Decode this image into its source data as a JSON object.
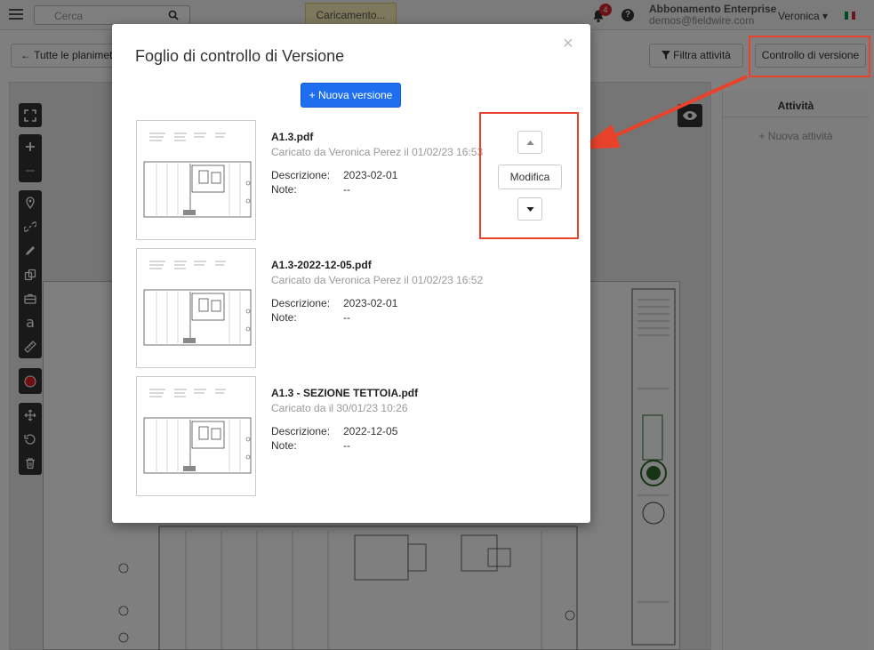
{
  "topbar": {
    "search_placeholder": "Cerca",
    "loading_text": "Caricamento...",
    "notification_count": "4",
    "help_label": "?",
    "plan": "Abbonamento Enterprise",
    "email": "demos@fieldwire.com",
    "user_name": "Veronica ▾",
    "flag_colors": [
      "#009246",
      "#ffffff",
      "#ce2b37"
    ]
  },
  "toolbar": {
    "back_label": "← Tutte le planimet",
    "filter_label": "Filtra attività",
    "version_control_label": "Controllo di versione"
  },
  "side_panel": {
    "title": "Attività",
    "add_label": "+ Nuova attività"
  },
  "tools": {
    "groups": [
      [
        "fullscreen-icon"
      ],
      [
        "zoom-in-icon",
        "zoom-out-icon"
      ],
      [
        "pin-icon",
        "link-icon",
        "pen-icon",
        "shapes-icon",
        "briefcase-icon",
        "text-icon",
        "ruler-icon"
      ],
      [
        "record-icon"
      ],
      [
        "move-icon",
        "rotate-icon",
        "trash-icon"
      ]
    ],
    "text_tool_label": "a"
  },
  "modal": {
    "title": "Foglio di controllo di Versione",
    "close_label": "×",
    "new_version_label": "+ Nuova versione",
    "edit_label": "Modifica",
    "versions": [
      {
        "name": "A1.3.pdf",
        "uploaded": "Caricato da Veronica Perez il 01/02/23 16:53",
        "desc_label": "Descrizione:",
        "desc_value": "2023-02-01",
        "note_label": "Note:",
        "note_value": "--"
      },
      {
        "name": "A1.3-2022-12-05.pdf",
        "uploaded": "Caricato da Veronica Perez il 01/02/23 16:52",
        "desc_label": "Descrizione:",
        "desc_value": "2023-02-01",
        "note_label": "Note:",
        "note_value": "--"
      },
      {
        "name": "A1.3 - SEZIONE TETTOIA.pdf",
        "uploaded": "Caricato da il 30/01/23 10:26",
        "desc_label": "Descrizione:",
        "desc_value": "2022-12-05",
        "note_label": "Note:",
        "note_value": "--"
      }
    ]
  },
  "colors": {
    "primary": "#1e6ef0",
    "highlight": "#e8422b",
    "badge": "#d9262c",
    "tool_bg": "#333333"
  }
}
